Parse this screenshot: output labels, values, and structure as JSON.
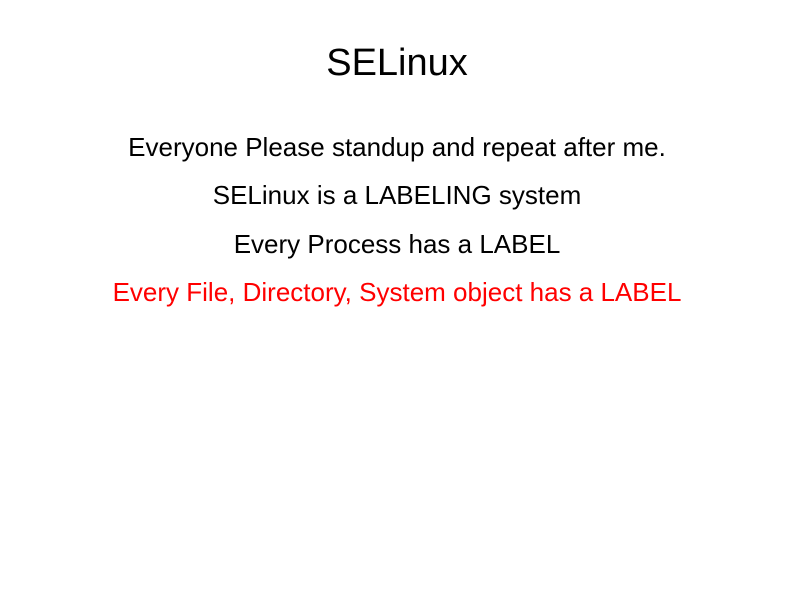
{
  "slide": {
    "title": "SELinux",
    "lines": [
      {
        "text": "Everyone Please standup and repeat after me.",
        "highlight": false
      },
      {
        "text": "SELinux is a LABELING system",
        "highlight": false
      },
      {
        "text": "Every Process has a LABEL",
        "highlight": false
      },
      {
        "text": "Every File, Directory, System object has a LABEL",
        "highlight": true
      }
    ]
  }
}
